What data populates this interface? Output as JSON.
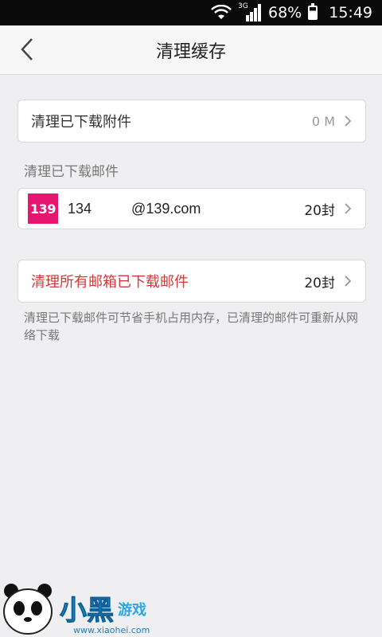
{
  "status_bar": {
    "network": "3G",
    "battery": "68%",
    "time": "15:49"
  },
  "header": {
    "title": "清理缓存",
    "back_icon": "chevron-left-icon"
  },
  "attachments": {
    "label": "清理已下载附件",
    "size": "0 M"
  },
  "mail_section": {
    "heading": "清理已下载邮件",
    "account": {
      "logo_text": "139",
      "email": "134          @139.com",
      "count": "20封",
      "logo_color": "#e6156f"
    }
  },
  "all_mailboxes": {
    "label": "清理所有邮箱已下载邮件",
    "count": "20封",
    "label_color": "#d23a3a"
  },
  "note": "清理已下载邮件可节省手机占用内存，已清理的邮件可重新从网络下载",
  "watermark": {
    "name": "小黑游戏",
    "url": "www.xiaohei.com"
  }
}
